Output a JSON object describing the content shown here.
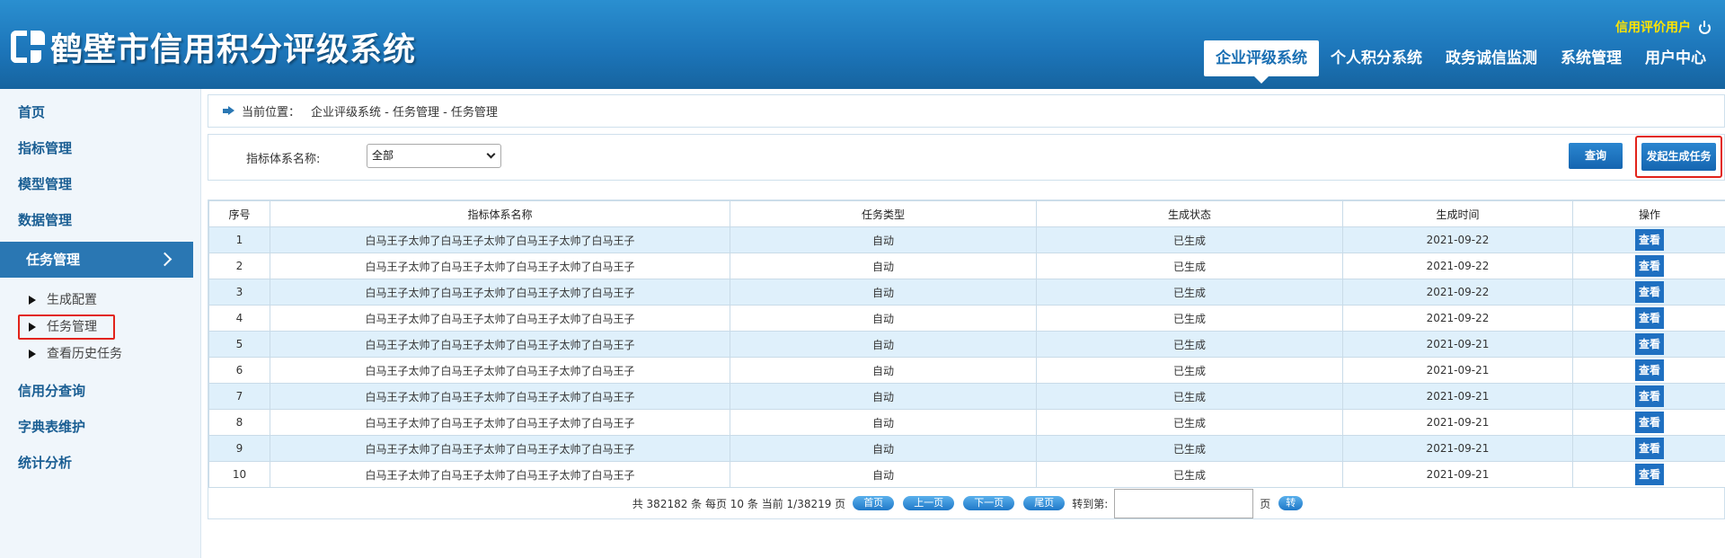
{
  "header": {
    "title": "鹤壁市信用积分评级系统",
    "user": "信用评价用户",
    "nav": [
      "企业评级系统",
      "个人积分系统",
      "政务诚信监测",
      "系统管理",
      "用户中心"
    ]
  },
  "sidebar": {
    "top_items": [
      "首页",
      "指标管理",
      "模型管理",
      "数据管理"
    ],
    "active": "任务管理",
    "sub_items": [
      "生成配置",
      "任务管理",
      "查看历史任务"
    ],
    "bottom_items": [
      "信用分查询",
      "字典表维护",
      "统计分析"
    ]
  },
  "breadcrumb": {
    "label": "当前位置：",
    "path": "企业评级系统 - 任务管理 - 任务管理"
  },
  "filter": {
    "label": "指标体系名称:",
    "select_value": "全部",
    "query_button": "查询",
    "launch_button": "发起生成任务"
  },
  "table": {
    "columns": [
      "序号",
      "指标体系名称",
      "任务类型",
      "生成状态",
      "生成时间",
      "操作"
    ],
    "rows": [
      [
        "1",
        "白马王子太帅了白马王子太帅了白马王子太帅了白马王子",
        "自动",
        "已生成",
        "2021-09-22",
        "查看"
      ],
      [
        "2",
        "白马王子太帅了白马王子太帅了白马王子太帅了白马王子",
        "自动",
        "已生成",
        "2021-09-22",
        "查看"
      ],
      [
        "3",
        "白马王子太帅了白马王子太帅了白马王子太帅了白马王子",
        "自动",
        "已生成",
        "2021-09-22",
        "查看"
      ],
      [
        "4",
        "白马王子太帅了白马王子太帅了白马王子太帅了白马王子",
        "自动",
        "已生成",
        "2021-09-22",
        "查看"
      ],
      [
        "5",
        "白马王子太帅了白马王子太帅了白马王子太帅了白马王子",
        "自动",
        "已生成",
        "2021-09-21",
        "查看"
      ],
      [
        "6",
        "白马王子太帅了白马王子太帅了白马王子太帅了白马王子",
        "自动",
        "已生成",
        "2021-09-21",
        "查看"
      ],
      [
        "7",
        "白马王子太帅了白马王子太帅了白马王子太帅了白马王子",
        "自动",
        "已生成",
        "2021-09-21",
        "查看"
      ],
      [
        "8",
        "白马王子太帅了白马王子太帅了白马王子太帅了白马王子",
        "自动",
        "已生成",
        "2021-09-21",
        "查看"
      ],
      [
        "9",
        "白马王子太帅了白马王子太帅了白马王子太帅了白马王子",
        "自动",
        "已生成",
        "2021-09-21",
        "查看"
      ],
      [
        "10",
        "白马王子太帅了白马王子太帅了白马王子太帅了白马王子",
        "自动",
        "已生成",
        "2021-09-21",
        "查看"
      ]
    ]
  },
  "pager": {
    "summary": "共 382182 条 每页 10 条 当前 1/38219 页",
    "first": "首页",
    "prev": "上一页",
    "next": "下一页",
    "last": "尾页",
    "goto_label": "转到第:",
    "page_unit": "页",
    "go": "转"
  },
  "colors": {
    "header": "#1c74b8",
    "accent": "#2a77b3",
    "row_alt": "#dff0fb",
    "highlight": "#e2231a",
    "user": "#ffe400"
  },
  "icons": [
    "logo-icon",
    "power-icon",
    "chevron-right-icon",
    "triangle-bullet-icon",
    "arrow-right-icon",
    "chevron-down-icon"
  ]
}
